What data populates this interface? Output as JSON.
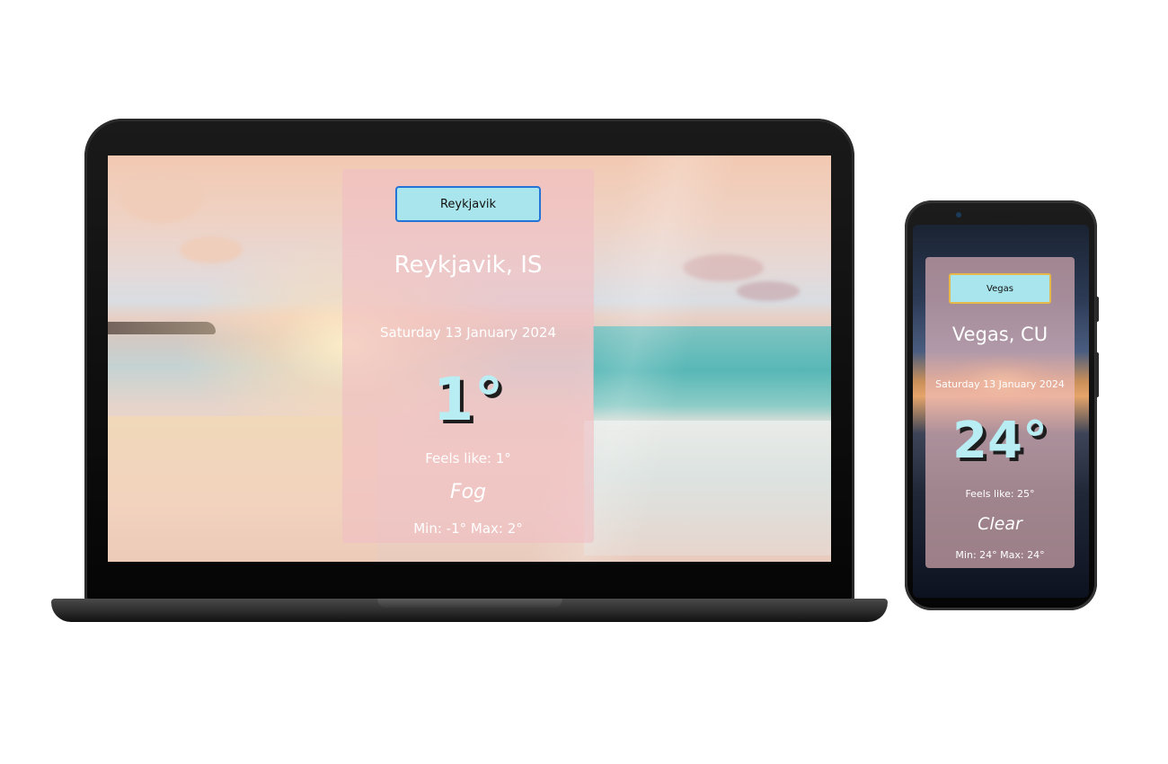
{
  "laptop": {
    "search": {
      "value": "Reykjavik"
    },
    "weather": {
      "city": "Reykjavik, IS",
      "date": "Saturday 13 January 2024",
      "temperature": "1°",
      "feels_like": "Feels like: 1°",
      "condition": "Fog",
      "min_max": "Min: -1° Max: 2°"
    }
  },
  "phone": {
    "search": {
      "value": "Vegas"
    },
    "weather": {
      "city": "Vegas, CU",
      "date": "Saturday 13 January 2024",
      "temperature": "24°",
      "feels_like": "Feels like: 25°",
      "condition": "Clear",
      "min_max": "Min: 24° Max: 24°"
    }
  },
  "colors": {
    "card_bg": "#f0bec3",
    "input_bg": "#a9e5ec",
    "laptop_input_border": "#2473d6",
    "phone_input_border": "#e6b84a",
    "temp_text": "#b8edf3"
  }
}
